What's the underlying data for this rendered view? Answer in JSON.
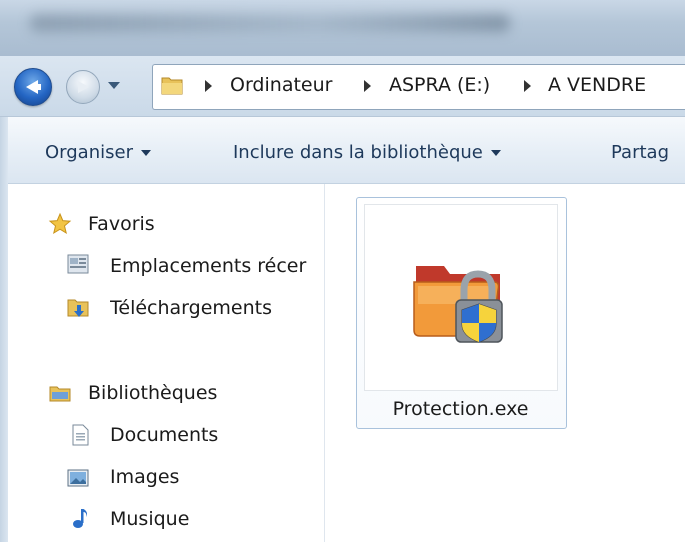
{
  "breadcrumb": {
    "items": [
      "Ordinateur",
      "ASPRA (E:)",
      "A VENDRE"
    ]
  },
  "toolbar": {
    "organize_label": "Organiser",
    "include_label": "Inclure dans la bibliothèque",
    "share_label": "Partag"
  },
  "navigation": {
    "favorites_label": "Favoris",
    "recent_places_label": "Emplacements récer",
    "downloads_label": "Téléchargements",
    "libraries_label": "Bibliothèques",
    "documents_label": "Documents",
    "images_label": "Images",
    "music_label": "Musique"
  },
  "files": [
    {
      "name": "Protection.exe",
      "icon": "locked-folder-shield-icon"
    }
  ],
  "icons": {
    "back": "back-arrow-icon",
    "forward": "forward-arrow-icon",
    "favorites": "star-icon",
    "recent": "recent-places-icon",
    "downloads": "downloads-folder-icon",
    "libraries": "libraries-icon",
    "documents": "document-icon",
    "images": "image-icon",
    "music": "music-note-icon"
  },
  "colors": {
    "accent_blue": "#2466c4",
    "toolbar_text": "#1e395b",
    "selection_border": "#a9c2dc"
  }
}
